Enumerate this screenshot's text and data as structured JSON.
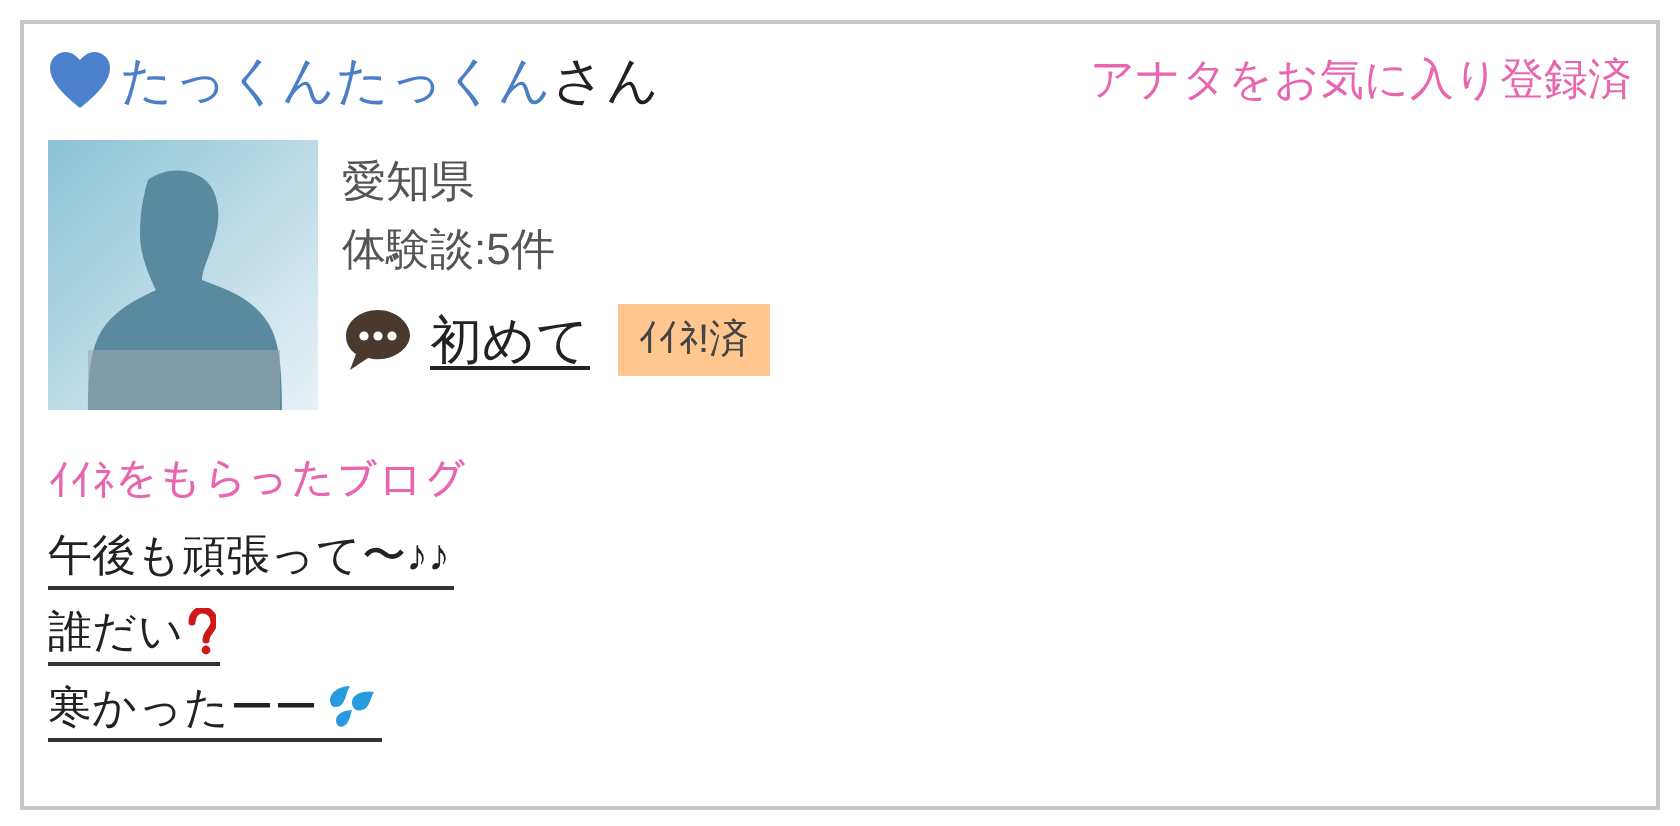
{
  "user": {
    "name": "たっくんたっくん",
    "suffix": "さん",
    "favorite": true
  },
  "favorite_status": "アナタをお気に入り登録済",
  "profile": {
    "prefecture": "愛知県",
    "experience_count": "体験談:5件"
  },
  "comment": {
    "label": "初めて",
    "like_badge": "ｲｲﾈ!済"
  },
  "liked_blogs": {
    "heading": "ｲｲﾈをもらったブログ",
    "items": [
      {
        "title": "午後も頑張って〜♪♪",
        "kind": "plain"
      },
      {
        "title": "誰だい",
        "kind": "question"
      },
      {
        "title": "寒かったーー",
        "kind": "sweat"
      }
    ]
  }
}
